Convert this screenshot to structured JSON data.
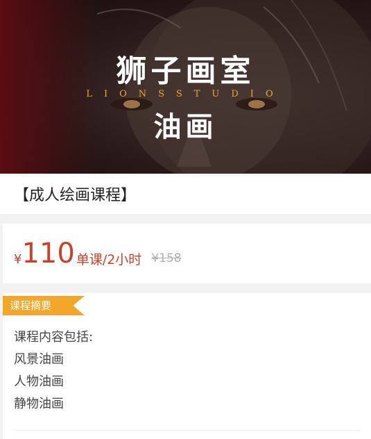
{
  "banner": {
    "title_main": "狮子画室",
    "studio": "LIONSSTUDIO",
    "title_sub": "油画"
  },
  "course": {
    "title": "【成人绘画课程】"
  },
  "price": {
    "currency": "¥",
    "amount": "110",
    "unit": "单课/2小时",
    "original": "¥158",
    "accent_color": "#c8412b"
  },
  "summary": {
    "tag": "课程摘要",
    "tag_color": "#f3a72a",
    "lines": [
      "课程内容包括:",
      "风景油画",
      "人物油画",
      "静物油画"
    ]
  }
}
